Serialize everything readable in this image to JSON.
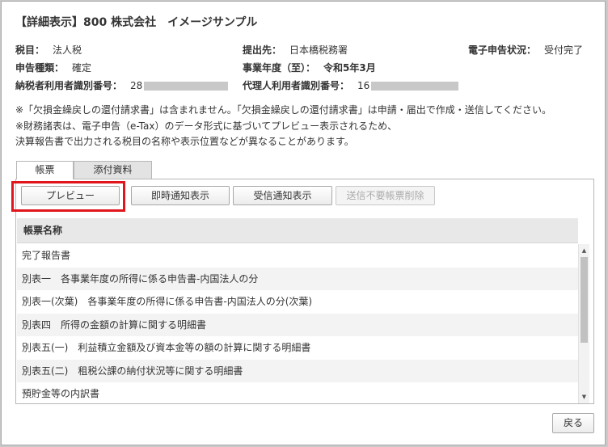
{
  "dialog": {
    "title": "【詳細表示】800 株式会社　イメージサンプル"
  },
  "info": {
    "tax_item_label": "税目：",
    "tax_item_value": "法人税",
    "submit_to_label": "提出先：",
    "submit_to_value": "日本橋税務署",
    "efile_status_label": "電子申告状況：",
    "efile_status_value": "受付完了",
    "filing_type_label": "申告種類：",
    "filing_type_value": "確定",
    "fiscal_year_label": "事業年度（至）：",
    "fiscal_year_value": "令和5年3月",
    "taxpayer_id_label": "納税者利用者識別番号：",
    "taxpayer_id_value": "28",
    "agent_id_label": "代理人利用者識別番号：",
    "agent_id_value": "16"
  },
  "notes": [
    "※「欠損金繰戻しの還付請求書」は含まれません。「欠損金繰戻しの還付請求書」は申請・届出で作成・送信してください。",
    "※財務諸表は、電子申告（e-Tax）のデータ形式に基づいてプレビュー表示されるため、",
    "決算報告書で出力される税目の名称や表示位置などが異なることがあります。"
  ],
  "tabs": {
    "forms": "帳票",
    "attachments": "添付資料"
  },
  "buttons": {
    "preview": "プレビュー",
    "instant_notice": "即時通知表示",
    "receipt_notice": "受信通知表示",
    "delete_unneeded": "送信不要帳票削除",
    "back": "戻る"
  },
  "list": {
    "header": "帳票名称",
    "rows": [
      "完了報告書",
      "別表一　各事業年度の所得に係る申告書-内国法人の分",
      "別表一(次葉)　各事業年度の所得に係る申告書-内国法人の分(次葉)",
      "別表四　所得の金額の計算に関する明細書",
      "別表五(一)　利益積立金額及び資本金等の額の計算に関する明細書",
      "別表五(二)　租税公課の納付状況等に関する明細書",
      "預貯金等の内訳書"
    ]
  },
  "colors": {
    "highlight": "#e0161c"
  }
}
